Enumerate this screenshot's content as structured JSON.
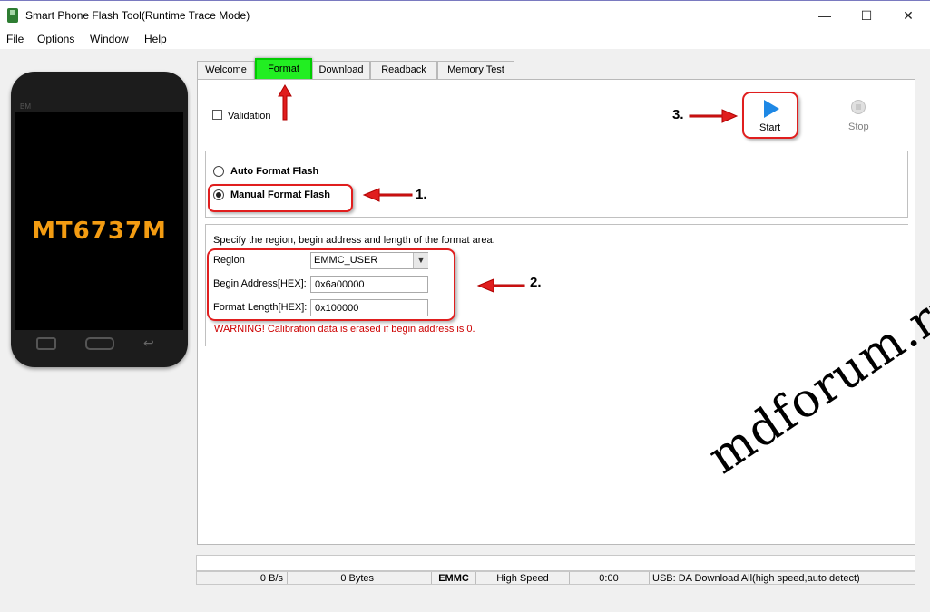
{
  "window": {
    "title": "Smart Phone Flash Tool(Runtime Trace Mode)",
    "minimize": "—",
    "maximize": "☐",
    "close": "✕"
  },
  "menu": [
    "File",
    "Options",
    "Window",
    "Help"
  ],
  "phone": {
    "brand": "BM",
    "chip": "MT6737M"
  },
  "tabs": [
    {
      "label": "Welcome",
      "active": false
    },
    {
      "label": "Format",
      "active": true
    },
    {
      "label": "Download",
      "active": false
    },
    {
      "label": "Readback",
      "active": false
    },
    {
      "label": "Memory Test",
      "active": false
    }
  ],
  "format": {
    "validation_label": "Validation",
    "validation_checked": false,
    "start_label": "Start",
    "stop_label": "Stop",
    "auto_label": "Auto Format Flash",
    "manual_label": "Manual Format Flash",
    "selected_mode": "manual",
    "specify_text": "Specify the region, begin address and length of the format area.",
    "region_label": "Region",
    "region_value": "EMMC_USER",
    "begin_label": "Begin Address[HEX]:",
    "begin_value": "0x6a00000",
    "length_label": "Format Length[HEX]:",
    "length_value": "0x100000",
    "warning": "WARNING! Calibration data is erased if begin address is 0."
  },
  "annotations": {
    "step1": "1.",
    "step2": "2.",
    "step3": "3."
  },
  "status": {
    "speed": "0 B/s",
    "bytes": "0 Bytes",
    "storage": "EMMC",
    "mode": "High Speed",
    "time": "0:00",
    "usb": "USB: DA Download All(high speed,auto detect)"
  },
  "watermark": "mdforum.ru",
  "colors": {
    "active_tab": "#22ee22",
    "highlight": "#e01e1e",
    "warning": "#cc0000",
    "start_icon": "#1e88e5"
  }
}
